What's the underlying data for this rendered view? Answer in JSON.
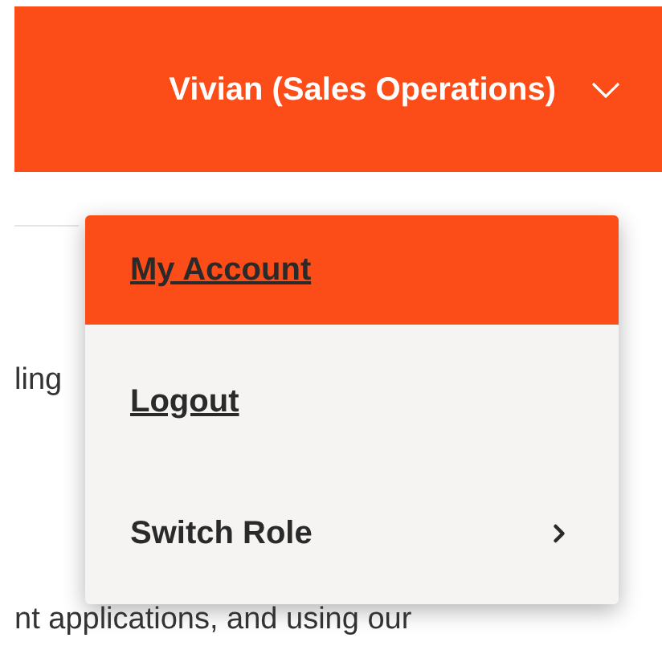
{
  "header": {
    "user_label": "Vivian (Sales Operations)",
    "expanded": true
  },
  "body_text": [
    "ling",
    "nt applications, and using our"
  ],
  "menu": {
    "items": [
      {
        "label": "My Account",
        "kind": "link",
        "selected": true
      },
      {
        "label": "Logout",
        "kind": "link",
        "selected": false
      },
      {
        "label": "Switch Role",
        "kind": "submenu",
        "selected": false
      }
    ]
  }
}
